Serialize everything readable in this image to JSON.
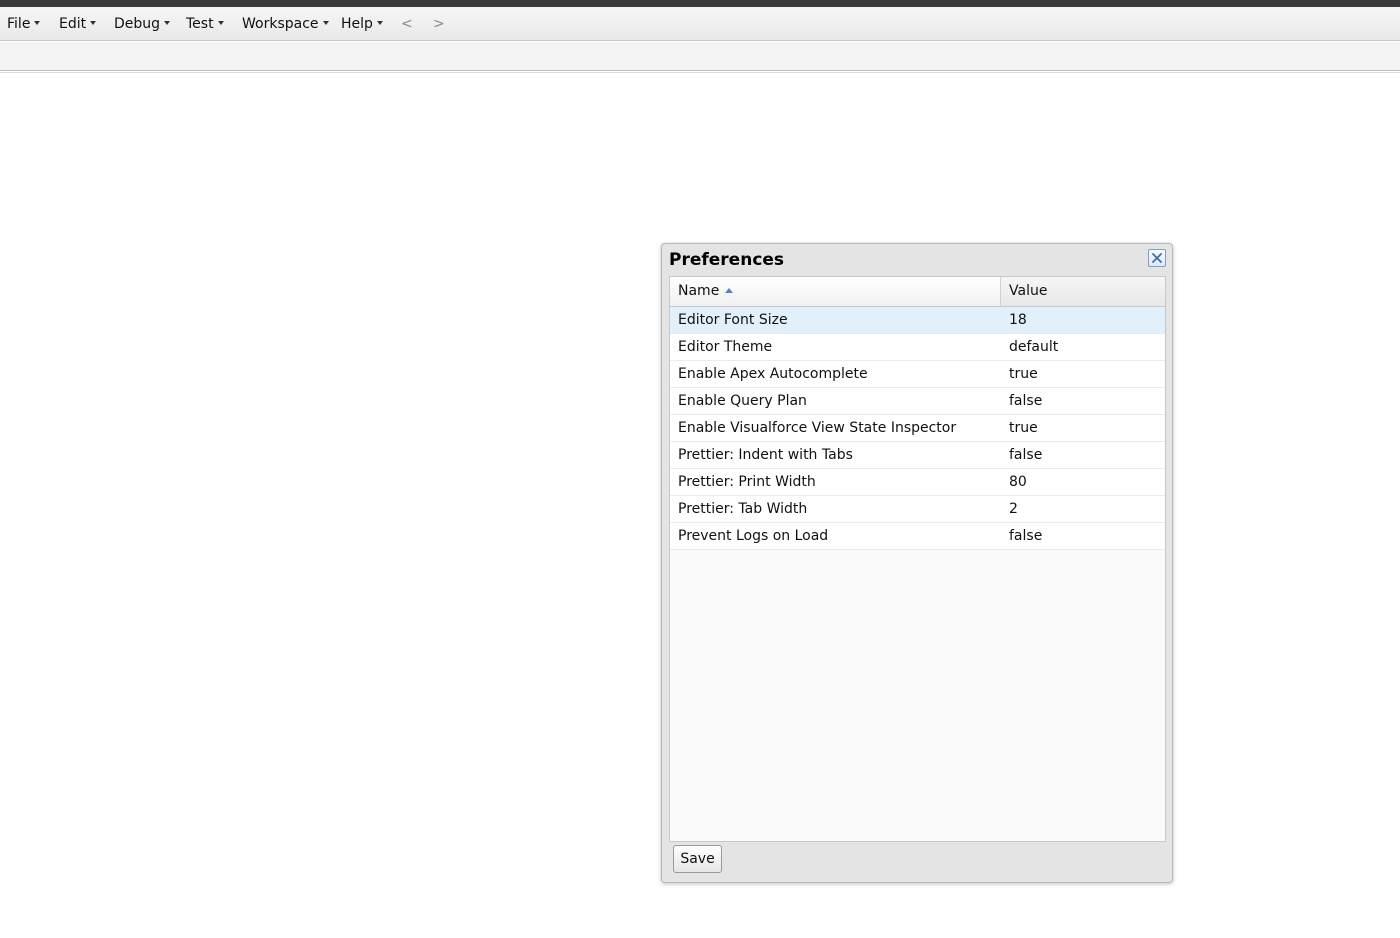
{
  "menubar": {
    "items": [
      {
        "label": "File"
      },
      {
        "label": "Edit"
      },
      {
        "label": "Debug"
      },
      {
        "label": "Test"
      },
      {
        "label": "Workspace"
      },
      {
        "label": "Help"
      }
    ],
    "back": "<",
    "forward": ">"
  },
  "dialog": {
    "title": "Preferences",
    "columns": {
      "name": "Name",
      "value": "Value"
    },
    "sort": {
      "column": "Name",
      "direction": "ascending"
    },
    "rows": [
      {
        "name": "Editor Font Size",
        "value": "18",
        "selected": true
      },
      {
        "name": "Editor Theme",
        "value": "default"
      },
      {
        "name": "Enable Apex Autocomplete",
        "value": "true"
      },
      {
        "name": "Enable Query Plan",
        "value": "false"
      },
      {
        "name": "Enable Visualforce View State Inspector",
        "value": "true"
      },
      {
        "name": "Prettier: Indent with Tabs",
        "value": "false"
      },
      {
        "name": "Prettier: Print Width",
        "value": "80"
      },
      {
        "name": "Prettier: Tab Width",
        "value": "2"
      },
      {
        "name": "Prevent Logs on Load",
        "value": "false"
      }
    ],
    "save_label": "Save"
  },
  "colors": {
    "selected_row": "#e2f0fb",
    "sort_indicator": "#4a86c8",
    "close_border": "#7f9fc6"
  },
  "icons": {
    "menu_caret": "caret-down-icon",
    "sort": "sort-ascending-icon",
    "close": "close-icon"
  }
}
